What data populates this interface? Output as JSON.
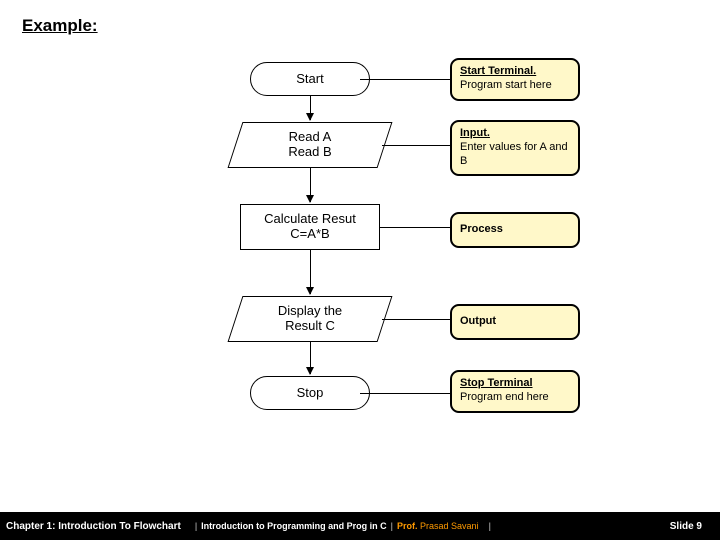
{
  "title": "Example:",
  "flow": {
    "start": {
      "label": "Start"
    },
    "input": {
      "line1": "Read  A",
      "line2": "Read  B"
    },
    "process": {
      "line1": "Calculate Resut",
      "line2": "C=A*B"
    },
    "output": {
      "line1": "Display the",
      "line2": "Result C"
    },
    "stop": {
      "label": "Stop"
    }
  },
  "annotations": {
    "start": {
      "head": "Start Terminal.",
      "body": "Program start here"
    },
    "input": {
      "head": "Input.",
      "body": "Enter values for A and B"
    },
    "process": {
      "head": "Process",
      "body": ""
    },
    "output": {
      "head": "Output",
      "body": ""
    },
    "stop": {
      "head": "Stop Terminal",
      "body": "Program end here"
    }
  },
  "footer": {
    "chapter": "Chapter 1: Introduction To Flowchart",
    "course": "Introduction to Programming and Prog in C",
    "prof_label": "Prof.",
    "prof_name": "Prasad Savani",
    "slide": "Slide 9"
  }
}
